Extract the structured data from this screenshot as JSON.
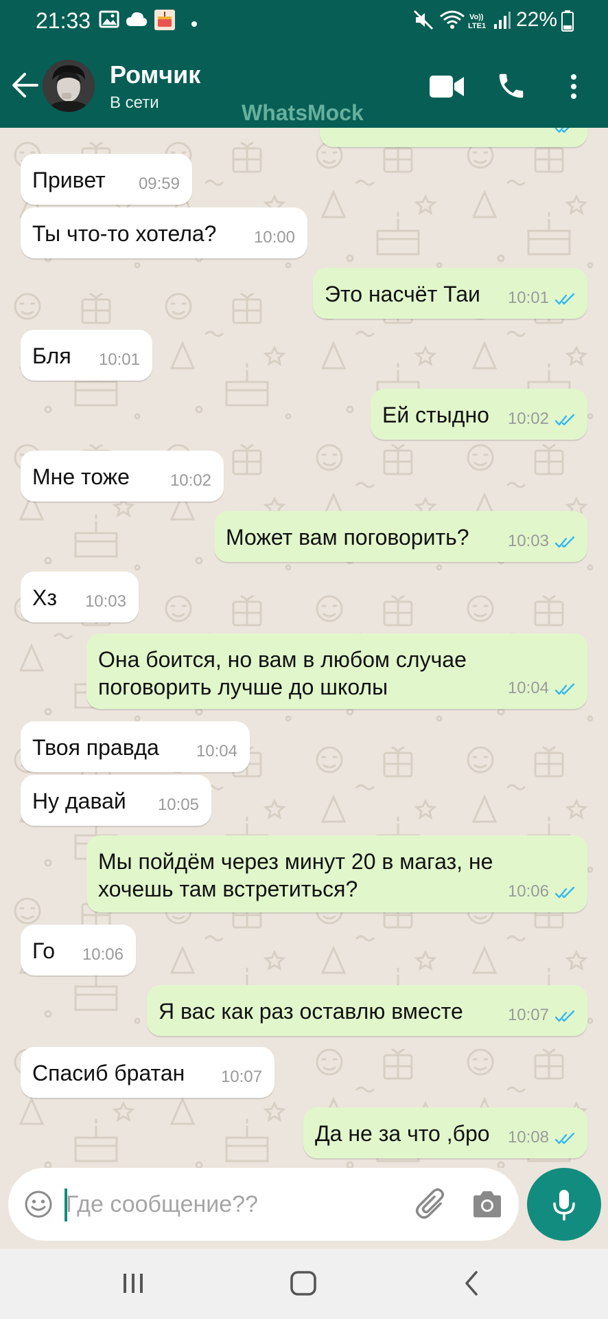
{
  "status_bar": {
    "time": "21:33",
    "battery": "22%",
    "lte_label": "Vo)) LTE1"
  },
  "header": {
    "contact_name": "Ромчик",
    "contact_status": "В сети",
    "watermark": "WhatsMock"
  },
  "messages": [
    {
      "dir": "in",
      "text": "Привет",
      "time": "09:59"
    },
    {
      "dir": "in",
      "text": "Ты что-то хотела?",
      "time": "10:00"
    },
    {
      "dir": "out",
      "text": "Это насчёт Таи",
      "time": "10:01",
      "status": "read"
    },
    {
      "dir": "in",
      "text": "Бля",
      "time": "10:01"
    },
    {
      "dir": "out",
      "text": "Ей стыдно",
      "time": "10:02",
      "status": "read"
    },
    {
      "dir": "in",
      "text": "Мне тоже",
      "time": "10:02"
    },
    {
      "dir": "out",
      "text": "Может вам поговорить?",
      "time": "10:03",
      "status": "read"
    },
    {
      "dir": "in",
      "text": "Хз",
      "time": "10:03"
    },
    {
      "dir": "out",
      "text": "Она боится, но вам в любом случае\nпоговорить лучше до школы",
      "time": "10:04",
      "status": "read"
    },
    {
      "dir": "in",
      "text": "Твоя правда",
      "time": "10:04"
    },
    {
      "dir": "in",
      "text": "Ну давай",
      "time": "10:05"
    },
    {
      "dir": "out",
      "text": "Мы пойдём через минут 20 в магаз, не\nхочешь там встретиться?",
      "time": "10:06",
      "status": "read"
    },
    {
      "dir": "in",
      "text": "Го",
      "time": "10:06"
    },
    {
      "dir": "out",
      "text": "Я вас как раз оставлю вместе",
      "time": "10:07",
      "status": "read"
    },
    {
      "dir": "in",
      "text": "Спасиб братан",
      "time": "10:07"
    },
    {
      "dir": "out",
      "text": "Да не за что ,бро",
      "time": "10:08",
      "status": "read"
    }
  ],
  "input": {
    "placeholder": "Где сообщение??",
    "value": ""
  },
  "icons": {
    "back": "arrow-left-icon",
    "video": "video-call-icon",
    "phone": "phone-icon",
    "menu": "more-vert-icon",
    "emoji": "emoji-icon",
    "attach": "paperclip-icon",
    "camera": "camera-icon",
    "mic": "microphone-icon",
    "read_ticks": "double-check-icon"
  },
  "colors": {
    "header_bg": "#075e54",
    "accent": "#128c7e",
    "incoming_bubble": "#ffffff",
    "outgoing_bubble": "#e1f7cb",
    "read_tick": "#34b7f1",
    "chat_bg": "#ece5dd"
  }
}
